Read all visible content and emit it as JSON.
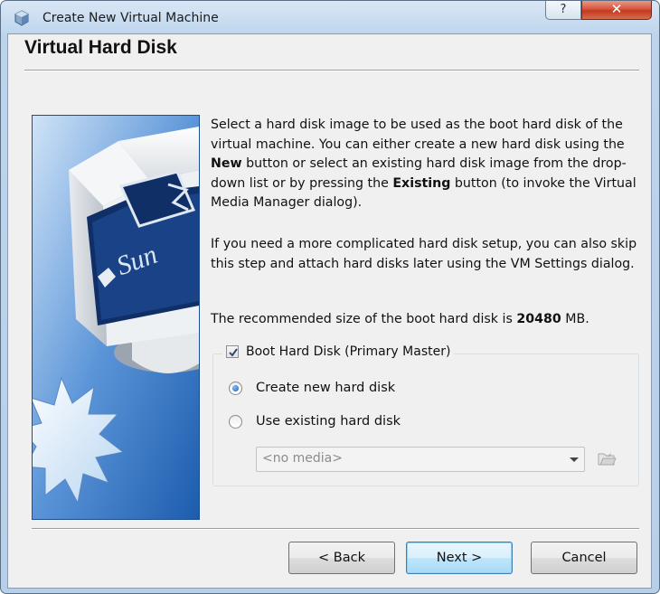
{
  "window": {
    "title": "Create New Virtual Machine",
    "help_label": "?",
    "close_label": "✕"
  },
  "page": {
    "heading": "Virtual Hard Disk",
    "para1": {
      "t1": "Select a hard disk image to be used as the boot hard disk of the virtual machine. You can either create a new hard disk using the ",
      "b1": "New",
      "t2": " button or select an existing hard disk image from the drop-down list or by pressing the ",
      "b2": "Existing",
      "t3": " button (to invoke the Virtual Media Manager dialog)."
    },
    "para2": "If you need a more complicated hard disk setup, you can also skip this step and attach hard disks later using the VM Settings dialog.",
    "para3": {
      "t1": "The recommended size of the boot hard disk is ",
      "size": "20480",
      "t2": " MB."
    },
    "side_image_brand": "Sun"
  },
  "boot_disk": {
    "label": "Boot Hard Disk (Primary Master)",
    "checked": true,
    "options": [
      {
        "label": "Create new hard disk",
        "selected": true
      },
      {
        "label": "Use existing hard disk",
        "selected": false
      }
    ],
    "media_value": "<no media>"
  },
  "buttons": {
    "back": "< Back",
    "next": "Next >",
    "cancel": "Cancel"
  },
  "colors": {
    "title_bar": "#bcd4ec",
    "close_button": "#c8432a",
    "side_image_blue": "#2f6fc0",
    "default_button": "#bee6fd"
  }
}
